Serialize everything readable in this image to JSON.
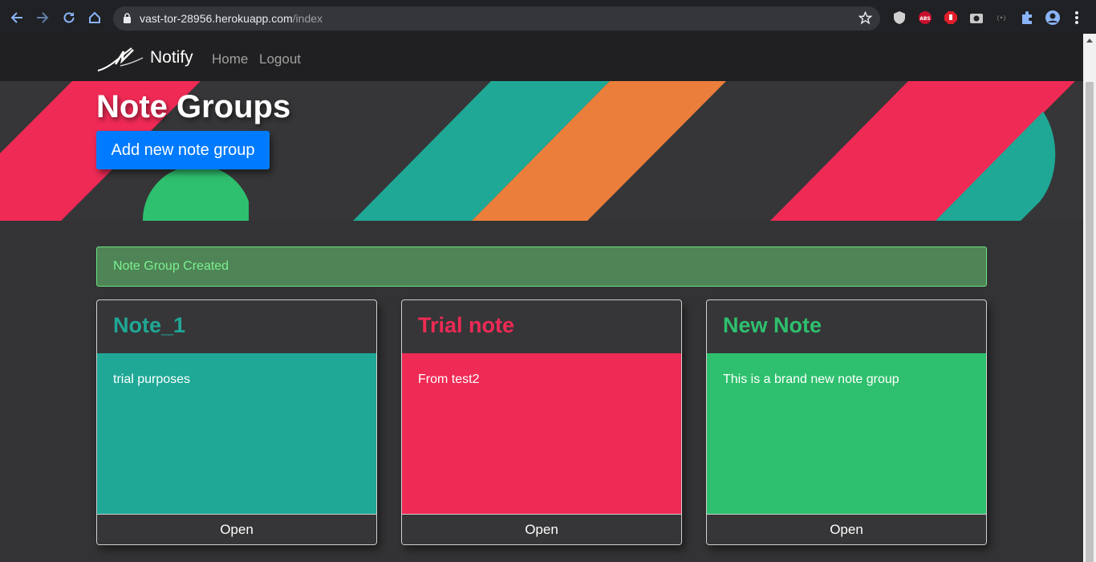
{
  "browser": {
    "url_host": "vast-tor-28956.herokuapp.com",
    "url_path": "/index",
    "extension_badge": "ABS"
  },
  "nav": {
    "brand": "Notify",
    "links": [
      "Home",
      "Logout"
    ]
  },
  "hero": {
    "title": "Note Groups",
    "button_label": "Add new note group"
  },
  "alert": {
    "message": "Note Group Created"
  },
  "cards": [
    {
      "title": "Note_1",
      "description": "trial purposes",
      "button_label": "Open",
      "color": "#1fa896"
    },
    {
      "title": "Trial note",
      "description": "From test2",
      "button_label": "Open",
      "color": "#ef2a55"
    },
    {
      "title": "New Note",
      "description": "This is a brand new note group",
      "button_label": "Open",
      "color": "#2ec06e"
    }
  ],
  "colors": {
    "background": "#333335",
    "nav": "#202022",
    "primary": "#007bff",
    "teal": "#1fa896",
    "red": "#ef2a55",
    "green": "#2ec06e",
    "orange": "#ec7e3b"
  }
}
